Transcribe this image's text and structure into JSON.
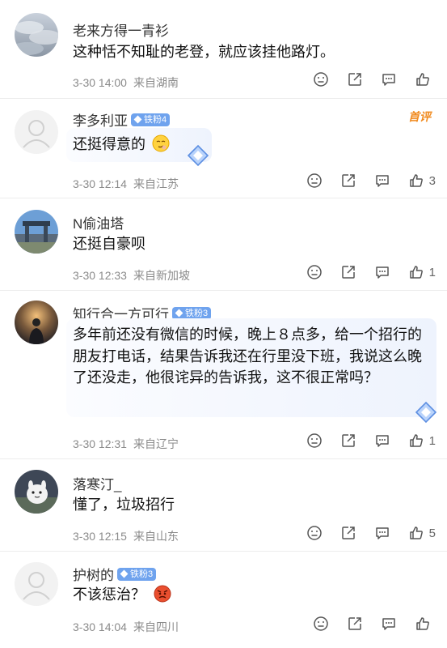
{
  "comments": [
    {
      "name": "老来方得一青衫",
      "badge": "",
      "text": "这种恬不知耻的老登，就应该挂他路灯。",
      "date": "3-30 14:00",
      "location": "来自湖南",
      "likes": "",
      "avatar": "sky"
    },
    {
      "name": "李多利亚",
      "badge": "铁粉4",
      "text": "还挺得意的",
      "date": "3-30 12:14",
      "location": "来自江苏",
      "likes": "3",
      "avatar": "default",
      "hot": "首评"
    },
    {
      "name": "N偷油塔",
      "badge": "",
      "text": "还挺自豪呗",
      "date": "3-30 12:33",
      "location": "来自新加坡",
      "likes": "1",
      "avatar": "gate"
    },
    {
      "name": "知行合一方可行",
      "badge": "铁粉3",
      "text": "多年前还没有微信的时候，晚上８点多，给一个招行的朋友打电话，结果告诉我还在行里没下班，我说这么晚了还没走，他很诧异的告诉我，这不很正常吗？",
      "date": "3-30 12:31",
      "location": "来自辽宁",
      "likes": "1",
      "avatar": "sunset"
    },
    {
      "name": "落寒汀_",
      "badge": "",
      "text": "懂了，垃圾招行",
      "date": "3-30 12:15",
      "location": "来自山东",
      "likes": "5",
      "avatar": "cartoon"
    },
    {
      "name": "护树的",
      "badge": "铁粉3",
      "text": "不该惩治？",
      "date": "3-30 14:04",
      "location": "来自四川",
      "likes": "",
      "avatar": "default"
    }
  ],
  "colors": {
    "badge": "#6fa3ee",
    "hot": "#f08a1e",
    "meta": "#8b8b8b"
  },
  "icons": [
    "face-icon",
    "share-icon",
    "comment-icon",
    "thumb-up-icon"
  ]
}
